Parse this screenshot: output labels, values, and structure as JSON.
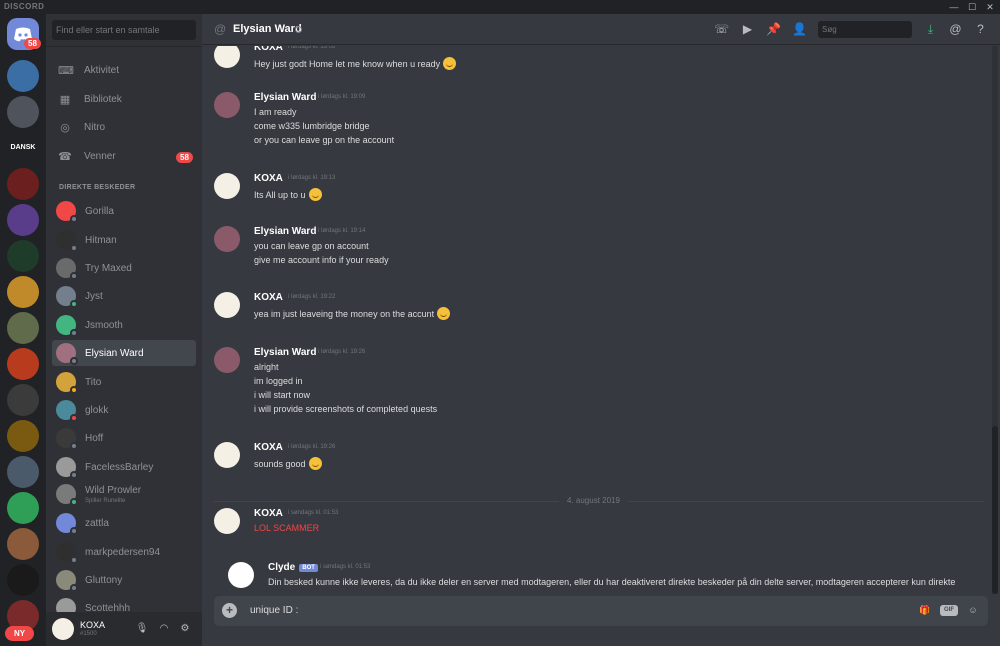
{
  "app": {
    "name": "DISCORD"
  },
  "window": {
    "min": "—",
    "max": "☐",
    "close": "✕"
  },
  "guilds": {
    "home_badge": "58",
    "ny_label": "NY",
    "dansk_label": "DANSK"
  },
  "dm_panel": {
    "search_placeholder": "Find eller start en samtale",
    "nav": [
      {
        "label": "Aktivitet",
        "icon": "gamepad-icon"
      },
      {
        "label": "Bibliotek",
        "icon": "library-icon"
      },
      {
        "label": "Nitro",
        "icon": "nitro-icon"
      },
      {
        "label": "Venner",
        "icon": "friends-icon",
        "badge": "58"
      }
    ],
    "section_label": "DIREKTE BESKEDER",
    "dms": [
      {
        "name": "Gorilla"
      },
      {
        "name": "Hitman"
      },
      {
        "name": "Try Maxed"
      },
      {
        "name": "Jyst"
      },
      {
        "name": "Jsmooth"
      },
      {
        "name": "Elysian Ward",
        "active": true
      },
      {
        "name": "Tito"
      },
      {
        "name": "glokk"
      },
      {
        "name": "Hoff"
      },
      {
        "name": "FacelessBarley"
      },
      {
        "name": "Wild Prowler",
        "sub": "Spiller Runelite"
      },
      {
        "name": "zattla"
      },
      {
        "name": "markpedersen94"
      },
      {
        "name": "Gluttony"
      },
      {
        "name": "Scottehhh"
      }
    ]
  },
  "user": {
    "name": "KOXA",
    "tag": "#1500"
  },
  "header": {
    "title": "Elysian Ward",
    "search_placeholder": "Søg"
  },
  "messages": [
    {
      "author": "KOXA",
      "time": "i lørdags kl. 19:08",
      "lines": [
        "Hey just godt Home let me know when u ready"
      ],
      "emoji_line": 0
    },
    {
      "author": "Elysian Ward",
      "time": "i lørdags kl. 19:09",
      "lines": [
        "I am ready",
        "come w335 lumbridge bridge",
        "or you can leave gp on the account"
      ]
    },
    {
      "author": "KOXA",
      "time": "i lørdags kl. 19:13",
      "lines": [
        "Its All up to u"
      ],
      "emoji_line": 0
    },
    {
      "author": "Elysian Ward",
      "time": "i lørdags kl. 19:14",
      "lines": [
        "you can leave gp on account",
        "give me account info if your ready"
      ]
    },
    {
      "author": "KOXA",
      "time": "i lørdags kl. 19:22",
      "lines": [
        "yea im just leaveing the money on the accunt"
      ],
      "emoji_line": 0
    },
    {
      "author": "Elysian Ward",
      "time": "i lørdags kl. 19:26",
      "lines": [
        "alright",
        "im logged in",
        "i will start now",
        "i will provide screenshots of completed quests"
      ]
    },
    {
      "author": "KOXA",
      "time": "i lørdags kl. 19:26",
      "lines": [
        "sounds good"
      ],
      "emoji_line": 0
    },
    {
      "author": "KOXA",
      "time": "i søndags kl. 01:53",
      "lines": [
        "LOL SCAMMER"
      ],
      "red": true
    },
    {
      "author": "Clyde",
      "bot": "BOT",
      "time": "i søndags kl. 01:53",
      "lines": [
        "Din besked kunne ikke leveres, da du ikke deler en server med modtageren, eller du har deaktiveret direkte beskeder på din delte server, modtageren accepterer kun direkte"
      ]
    }
  ],
  "date_divider": "4. august 2019",
  "composer": {
    "value": "unique ID :",
    "gif": "GIF"
  },
  "colors": {
    "blurple": "#7289da",
    "red": "#f04747",
    "green": "#43b581",
    "bg": "#36393f"
  }
}
